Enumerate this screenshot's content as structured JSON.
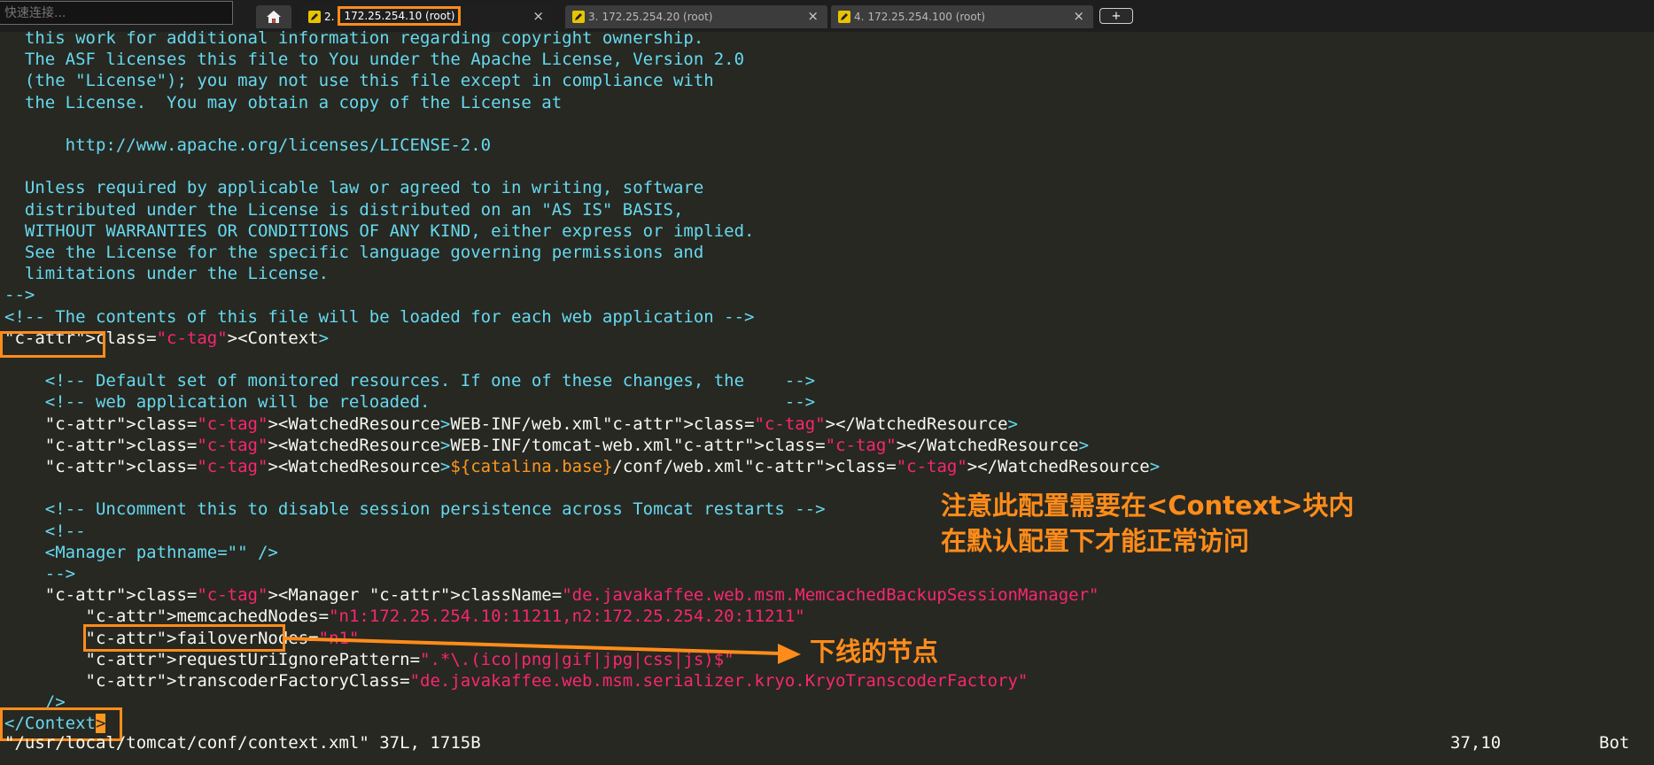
{
  "app": {
    "quick_connect_placeholder": "快速连接...",
    "tabs": [
      {
        "num": "2.",
        "title": "172.25.254.10 (root)",
        "active": true
      },
      {
        "num": "3.",
        "title": "172.25.254.20 (root)",
        "active": false
      },
      {
        "num": "4.",
        "title": "172.25.254.100 (root)",
        "active": false
      }
    ],
    "close_glyph": "×",
    "new_tab_glyph": "+"
  },
  "colors": {
    "background": "#272822",
    "comment": "#66d9ef",
    "attribute": "#a6e22e",
    "string": "#f92672",
    "annotation": "#ff8c1a"
  },
  "editor": {
    "lines": [
      "  this work for additional information regarding copyright ownership.",
      "  The ASF licenses this file to You under the Apache License, Version 2.0",
      "  (the \"License\"); you may not use this file except in compliance with",
      "  the License.  You may obtain a copy of the License at",
      "",
      "      http://www.apache.org/licenses/LICENSE-2.0",
      "",
      "  Unless required by applicable law or agreed to in writing, software",
      "  distributed under the License is distributed on an \"AS IS\" BASIS,",
      "  WITHOUT WARRANTIES OR CONDITIONS OF ANY KIND, either express or implied.",
      "  See the License for the specific language governing permissions and",
      "  limitations under the License.",
      "-->",
      "<!-- The contents of this file will be loaded for each web application -->",
      "<Context>",
      "",
      "    <!-- Default set of monitored resources. If one of these changes, the    -->",
      "    <!-- web application will be reloaded.                                   -->",
      "    <WatchedResource>WEB-INF/web.xml</WatchedResource>",
      "    <WatchedResource>WEB-INF/tomcat-web.xml</WatchedResource>",
      "    <WatchedResource>${catalina.base}/conf/web.xml</WatchedResource>",
      "",
      "    <!-- Uncomment this to disable session persistence across Tomcat restarts -->",
      "    <!--",
      "    <Manager pathname=\"\" />",
      "    -->",
      "    <Manager className=\"de.javakaffee.web.msm.MemcachedBackupSessionManager\"",
      "        memcachedNodes=\"n1:172.25.254.10:11211,n2:172.25.254.20:11211\"",
      "        failoverNodes=\"n1\"",
      "        requestUriIgnorePattern=\".*\\.(ico|png|gif|jpg|css|js)$\"",
      "        transcoderFactoryClass=\"de.javakaffee.web.msm.serializer.kryo.KryoTranscoderFactory\"",
      "    />",
      "</Context>"
    ]
  },
  "status": {
    "file_info": "\"/usr/local/tomcat/conf/context.xml\" 37L, 1715B",
    "position": "37,10",
    "scroll": "Bot"
  },
  "annotations": {
    "note_line1": "注意此配置需要在<Context>块内",
    "note_line2": "在默认配置下才能正常访问",
    "offline_node_note": "下线的节点"
  }
}
